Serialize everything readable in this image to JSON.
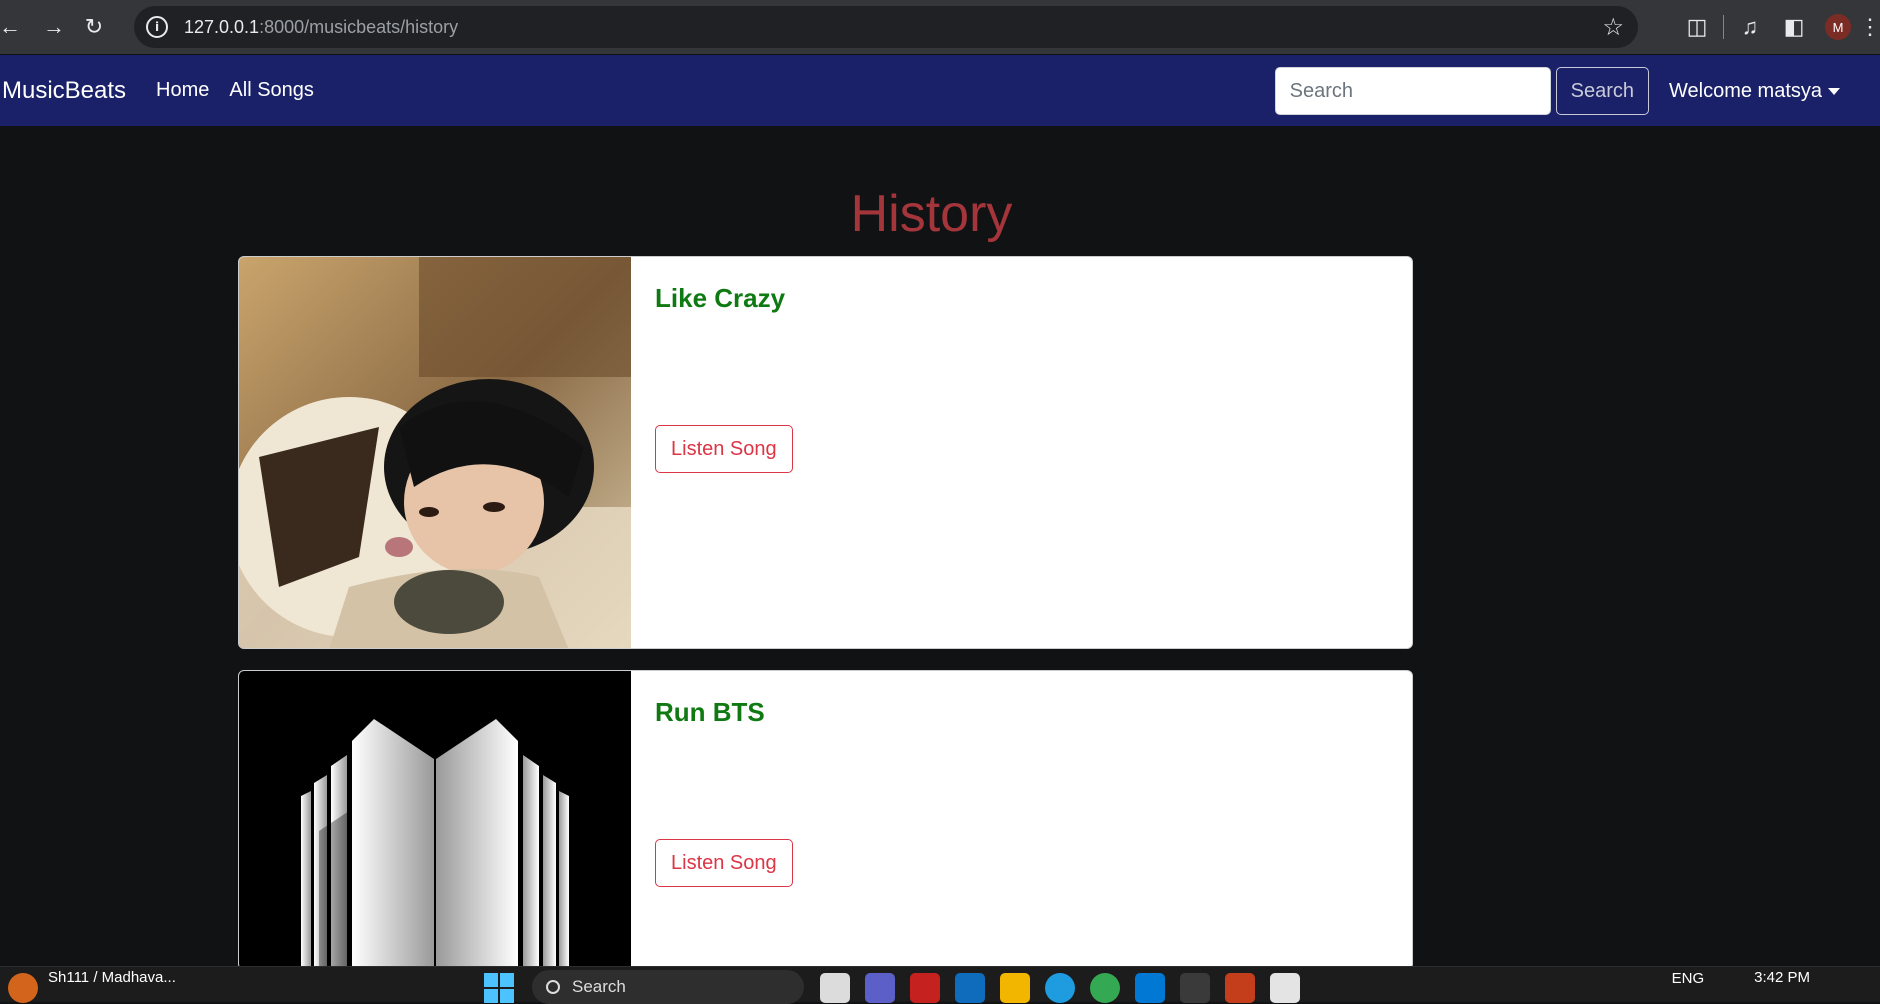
{
  "browser": {
    "url_host": "127.0.0.1",
    "url_rest": ":8000/musicbeats/history"
  },
  "navbar": {
    "brand": "MusicBeats",
    "links": [
      "Home",
      "All Songs"
    ],
    "search_placeholder": "Search",
    "search_button": "Search",
    "welcome": "Welcome matsya"
  },
  "page": {
    "heading": "History"
  },
  "songs": [
    {
      "title": "Like Crazy",
      "button": "Listen Song"
    },
    {
      "title": "Run BTS",
      "button": "Listen Song"
    }
  ],
  "taskbar": {
    "notification_title": "Sh111 / Madhava...",
    "search_label": "Search",
    "language": "ENG",
    "time": "3:42 PM"
  },
  "colors": {
    "navbar": "#1a2169",
    "heading": "#a4353b",
    "song_title": "#0f7a12",
    "listen_button": "#dc3545"
  }
}
